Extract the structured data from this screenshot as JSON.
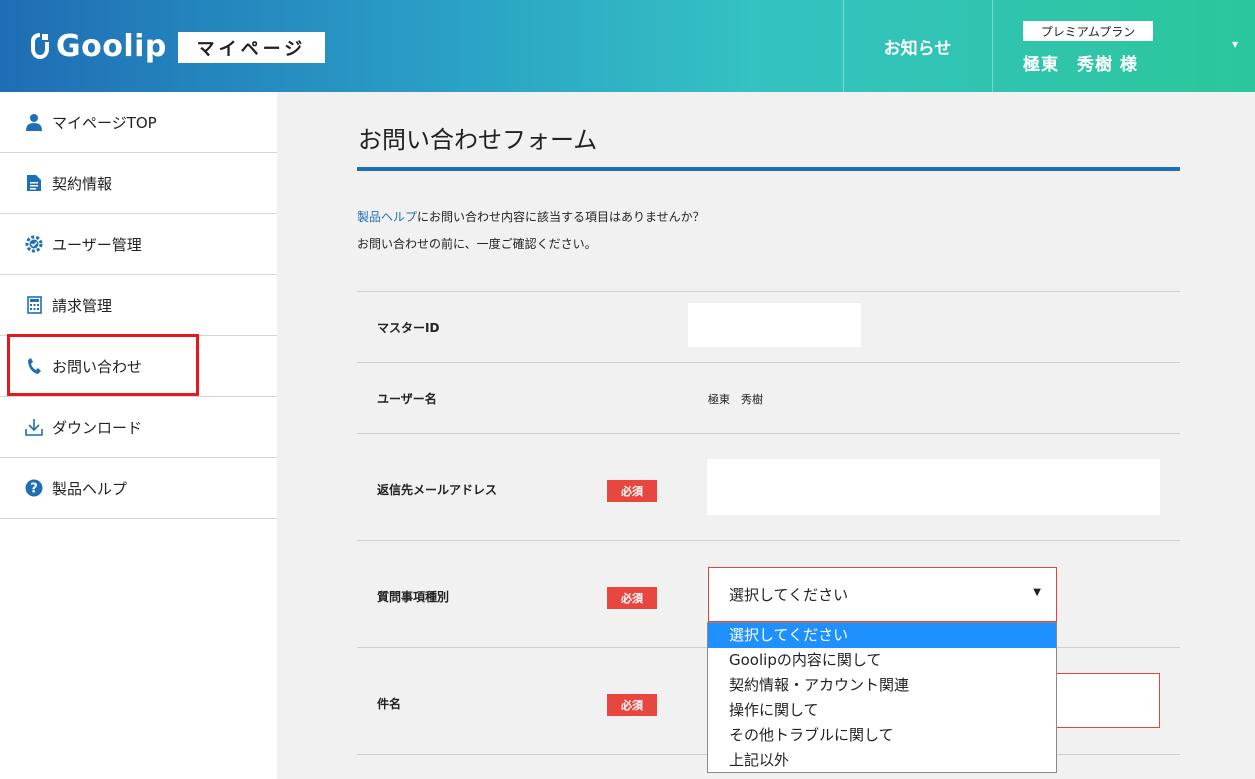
{
  "header": {
    "logo_text": "Goolip",
    "mypage_label": "マイページ",
    "notice_label": "お知らせ",
    "plan_badge": "プレミアムプラン",
    "user_name": "極東　秀樹 様"
  },
  "sidebar": {
    "items": [
      {
        "label": "マイページTOP",
        "icon": "person-icon"
      },
      {
        "label": "契約情報",
        "icon": "document-icon"
      },
      {
        "label": "ユーザー管理",
        "icon": "user-gear-icon"
      },
      {
        "label": "請求管理",
        "icon": "calculator-icon"
      },
      {
        "label": "お問い合わせ",
        "icon": "phone-icon"
      },
      {
        "label": "ダウンロード",
        "icon": "download-icon"
      },
      {
        "label": "製品ヘルプ",
        "icon": "help-icon"
      }
    ],
    "highlighted_index": 4
  },
  "main": {
    "title": "お問い合わせフォーム",
    "intro_link": "製品ヘルプ",
    "intro_line1_rest": "にお問い合わせ内容に該当する項目はありませんか？",
    "intro_line2": "お問い合わせの前に、一度ご確認ください。",
    "form": {
      "master_id_label": "マスターID",
      "master_id_value": "",
      "username_label": "ユーザー名",
      "username_value": "極東　秀樹",
      "email_label": "返信先メールアドレス",
      "email_value": "",
      "category_label": "質問事項種別",
      "category_selected": "選択してください",
      "subject_label": "件名",
      "subject_value": "",
      "required_label": "必須"
    },
    "dropdown_options": [
      "選択してください",
      "Goolipの内容に関して",
      "契約情報・アカウント関連",
      "操作に関して",
      "その他トラブルに関して",
      "上記以外"
    ]
  },
  "colors": {
    "accent_blue": "#1e6fb5",
    "required_red": "#e8473f",
    "highlight_red": "#e3191e",
    "selected_option": "#1e90ff"
  }
}
